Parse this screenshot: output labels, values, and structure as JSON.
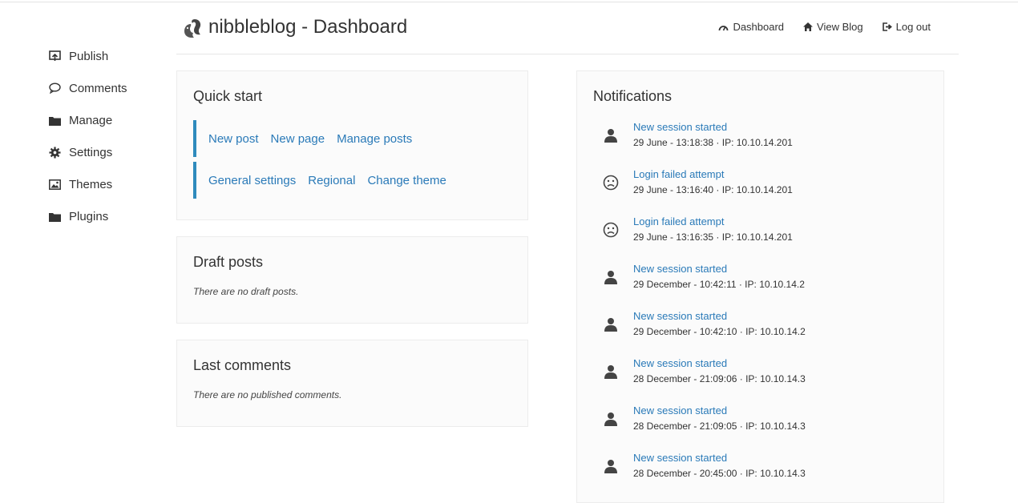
{
  "app": {
    "title": "nibbleblog - Dashboard"
  },
  "topnav": {
    "dashboard": "Dashboard",
    "view_blog": "View Blog",
    "log_out": "Log out"
  },
  "sidebar": {
    "items": [
      {
        "label": "Publish",
        "icon": "publish-icon"
      },
      {
        "label": "Comments",
        "icon": "comment-icon"
      },
      {
        "label": "Manage",
        "icon": "folder-icon"
      },
      {
        "label": "Settings",
        "icon": "gear-icon"
      },
      {
        "label": "Themes",
        "icon": "image-icon"
      },
      {
        "label": "Plugins",
        "icon": "folder-icon"
      }
    ]
  },
  "quick_start": {
    "title": "Quick start",
    "row1": [
      "New post",
      "New page",
      "Manage posts"
    ],
    "row2": [
      "General settings",
      "Regional",
      "Change theme"
    ]
  },
  "draft_posts": {
    "title": "Draft posts",
    "empty": "There are no draft posts."
  },
  "last_comments": {
    "title": "Last comments",
    "empty": "There are no published comments."
  },
  "notifications": {
    "title": "Notifications",
    "items": [
      {
        "type": "user",
        "title": "New session started",
        "meta": "29 June - 13:18:38 · IP: 10.10.14.201"
      },
      {
        "type": "sad",
        "title": "Login failed attempt",
        "meta": "29 June - 13:16:40 · IP: 10.10.14.201"
      },
      {
        "type": "sad",
        "title": "Login failed attempt",
        "meta": "29 June - 13:16:35 · IP: 10.10.14.201"
      },
      {
        "type": "user",
        "title": "New session started",
        "meta": "29 December - 10:42:11 · IP: 10.10.14.2"
      },
      {
        "type": "user",
        "title": "New session started",
        "meta": "29 December - 10:42:10 · IP: 10.10.14.2"
      },
      {
        "type": "user",
        "title": "New session started",
        "meta": "28 December - 21:09:06 · IP: 10.10.14.3"
      },
      {
        "type": "user",
        "title": "New session started",
        "meta": "28 December - 21:09:05 · IP: 10.10.14.3"
      },
      {
        "type": "user",
        "title": "New session started",
        "meta": "28 December - 20:45:00 · IP: 10.10.14.3"
      }
    ]
  },
  "colors": {
    "link": "#2a7ab8",
    "accent_bar": "#2f8bbd",
    "panel_bg": "#fbfbfb"
  }
}
